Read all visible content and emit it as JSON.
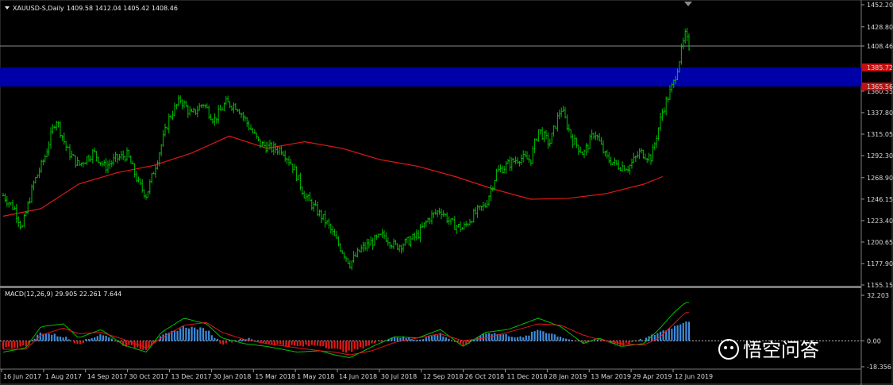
{
  "header": {
    "symbol_label": "XAUUSD-S,Daily",
    "ohlc": "1409.58 1412.04 1405.42 1408.46"
  },
  "indicator": {
    "label": "MACD(12,26,9) 29.905 22.261 7.644"
  },
  "watermark": {
    "text": "悟空问答"
  },
  "colors": {
    "background": "#000000",
    "candles": "#00c000",
    "moving_average": "#e01818",
    "zone": "#0000a8",
    "macd_positive": "#3c8ce0",
    "macd_negative": "#e01818",
    "macd_line": "#00c000",
    "signal_line": "#e01818",
    "grid": "#7a7a7a"
  },
  "chart_data": {
    "type": "candlestick",
    "symbol": "XAUUSD-S",
    "timeframe": "Daily",
    "price_ticks": [
      "1452.20",
      "1428.80",
      "1408.46",
      "1385.72",
      "1360.55",
      "1337.80",
      "1315.05",
      "1292.30",
      "1268.90",
      "1246.15",
      "1223.40",
      "1200.65",
      "1177.90",
      "1155.15"
    ],
    "current_price": 1408.46,
    "zone_labels": [
      "1385.72",
      "1365.56"
    ],
    "zone_range": [
      1365.56,
      1385.72
    ],
    "ylim": [
      1155.15,
      1452.2
    ],
    "date_labels": [
      "16 Jun 2017",
      "1 Aug 2017",
      "14 Sep 2017",
      "30 Oct 2017",
      "13 Dec 2017",
      "30 Jan 2018",
      "15 Mar 2018",
      "1 May 2018",
      "14 Jun 2018",
      "30 Jul 2018",
      "12 Sep 2018",
      "26 Oct 2018",
      "11 Dec 2018",
      "28 Jan 2019",
      "13 Mar 2019",
      "29 Apr 2019",
      "12 Jun 2019"
    ],
    "price_path": [
      [
        0,
        1250
      ],
      [
        3,
        1236
      ],
      [
        5,
        1215
      ],
      [
        8,
        1262
      ],
      [
        11,
        1290
      ],
      [
        14,
        1332
      ],
      [
        17,
        1298
      ],
      [
        20,
        1282
      ],
      [
        24,
        1296
      ],
      [
        27,
        1280
      ],
      [
        30,
        1289
      ],
      [
        33,
        1293
      ],
      [
        36,
        1262
      ],
      [
        38,
        1250
      ],
      [
        41,
        1290
      ],
      [
        44,
        1332
      ],
      [
        47,
        1352
      ],
      [
        50,
        1335
      ],
      [
        53,
        1348
      ],
      [
        56,
        1330
      ],
      [
        59,
        1348
      ],
      [
        62,
        1345
      ],
      [
        65,
        1325
      ],
      [
        68,
        1305
      ],
      [
        71,
        1300
      ],
      [
        74,
        1299
      ],
      [
        77,
        1280
      ],
      [
        80,
        1250
      ],
      [
        83,
        1235
      ],
      [
        86,
        1220
      ],
      [
        89,
        1198
      ],
      [
        92,
        1178
      ],
      [
        95,
        1193
      ],
      [
        98,
        1201
      ],
      [
        101,
        1208
      ],
      [
        104,
        1196
      ],
      [
        107,
        1200
      ],
      [
        110,
        1208
      ],
      [
        113,
        1226
      ],
      [
        116,
        1235
      ],
      [
        119,
        1220
      ],
      [
        122,
        1215
      ],
      [
        125,
        1230
      ],
      [
        128,
        1240
      ],
      [
        131,
        1275
      ],
      [
        134,
        1283
      ],
      [
        137,
        1290
      ],
      [
        140,
        1288
      ],
      [
        142,
        1320
      ],
      [
        145,
        1305
      ],
      [
        148,
        1343
      ],
      [
        151,
        1310
      ],
      [
        154,
        1294
      ],
      [
        157,
        1318
      ],
      [
        160,
        1290
      ],
      [
        163,
        1282
      ],
      [
        166,
        1280
      ],
      [
        169,
        1296
      ],
      [
        172,
        1290
      ],
      [
        175,
        1340
      ],
      [
        178,
        1370
      ],
      [
        181,
        1420
      ],
      [
        182,
        1408
      ]
    ],
    "ma_path": [
      [
        0,
        1228
      ],
      [
        10,
        1236
      ],
      [
        20,
        1262
      ],
      [
        30,
        1274
      ],
      [
        40,
        1282
      ],
      [
        50,
        1295
      ],
      [
        60,
        1313
      ],
      [
        70,
        1300
      ],
      [
        80,
        1307
      ],
      [
        90,
        1300
      ],
      [
        100,
        1288
      ],
      [
        110,
        1281
      ],
      [
        120,
        1270
      ],
      [
        130,
        1257
      ],
      [
        140,
        1246
      ],
      [
        150,
        1247
      ],
      [
        160,
        1252
      ],
      [
        170,
        1262
      ],
      [
        175,
        1270
      ]
    ],
    "macd": {
      "label": "MACD(12,26,9)",
      "values": [
        29.905,
        22.261,
        7.644
      ],
      "ylim": [
        -18.356,
        32.203
      ],
      "tick_labels": [
        "32.203",
        "0.00",
        "-18.356"
      ],
      "histogram_path": [
        [
          0,
          -5
        ],
        [
          6,
          -4
        ],
        [
          10,
          6
        ],
        [
          16,
          3
        ],
        [
          20,
          -2
        ],
        [
          26,
          5
        ],
        [
          32,
          -3
        ],
        [
          38,
          -6
        ],
        [
          42,
          3
        ],
        [
          48,
          10
        ],
        [
          54,
          8
        ],
        [
          58,
          -2
        ],
        [
          64,
          2
        ],
        [
          70,
          -2
        ],
        [
          78,
          -4
        ],
        [
          84,
          -3
        ],
        [
          88,
          -6
        ],
        [
          92,
          -8
        ],
        [
          98,
          -2
        ],
        [
          104,
          3
        ],
        [
          110,
          1
        ],
        [
          116,
          5
        ],
        [
          122,
          -4
        ],
        [
          128,
          6
        ],
        [
          134,
          4
        ],
        [
          138,
          2
        ],
        [
          142,
          8
        ],
        [
          148,
          3
        ],
        [
          154,
          -2
        ],
        [
          158,
          1
        ],
        [
          164,
          -3
        ],
        [
          170,
          1
        ],
        [
          174,
          6
        ],
        [
          178,
          10
        ],
        [
          181,
          14
        ]
      ],
      "macd_path": [
        [
          0,
          -8
        ],
        [
          6,
          -5
        ],
        [
          10,
          10
        ],
        [
          16,
          12
        ],
        [
          20,
          2
        ],
        [
          26,
          8
        ],
        [
          32,
          -3
        ],
        [
          38,
          -8
        ],
        [
          42,
          6
        ],
        [
          48,
          16
        ],
        [
          54,
          12
        ],
        [
          58,
          2
        ],
        [
          64,
          -2
        ],
        [
          70,
          -4
        ],
        [
          78,
          -8
        ],
        [
          84,
          -7
        ],
        [
          88,
          -10
        ],
        [
          92,
          -12
        ],
        [
          98,
          -4
        ],
        [
          104,
          3
        ],
        [
          110,
          2
        ],
        [
          116,
          8
        ],
        [
          122,
          -4
        ],
        [
          128,
          6
        ],
        [
          134,
          8
        ],
        [
          138,
          12
        ],
        [
          142,
          16
        ],
        [
          148,
          10
        ],
        [
          154,
          -2
        ],
        [
          158,
          2
        ],
        [
          164,
          -4
        ],
        [
          170,
          -2
        ],
        [
          174,
          8
        ],
        [
          178,
          20
        ],
        [
          181,
          27
        ]
      ],
      "signal_path": [
        [
          0,
          -6
        ],
        [
          6,
          -6
        ],
        [
          10,
          4
        ],
        [
          16,
          9
        ],
        [
          20,
          5
        ],
        [
          26,
          6
        ],
        [
          32,
          1
        ],
        [
          38,
          -5
        ],
        [
          42,
          2
        ],
        [
          48,
          11
        ],
        [
          54,
          13
        ],
        [
          58,
          6
        ],
        [
          64,
          1
        ],
        [
          70,
          -2
        ],
        [
          78,
          -5
        ],
        [
          84,
          -7
        ],
        [
          88,
          -8
        ],
        [
          92,
          -10
        ],
        [
          98,
          -7
        ],
        [
          104,
          -1
        ],
        [
          110,
          2
        ],
        [
          116,
          5
        ],
        [
          122,
          0
        ],
        [
          128,
          2
        ],
        [
          134,
          6
        ],
        [
          138,
          9
        ],
        [
          142,
          12
        ],
        [
          148,
          11
        ],
        [
          154,
          4
        ],
        [
          158,
          1
        ],
        [
          164,
          -2
        ],
        [
          170,
          -3
        ],
        [
          174,
          2
        ],
        [
          178,
          12
        ],
        [
          181,
          20
        ]
      ]
    }
  }
}
